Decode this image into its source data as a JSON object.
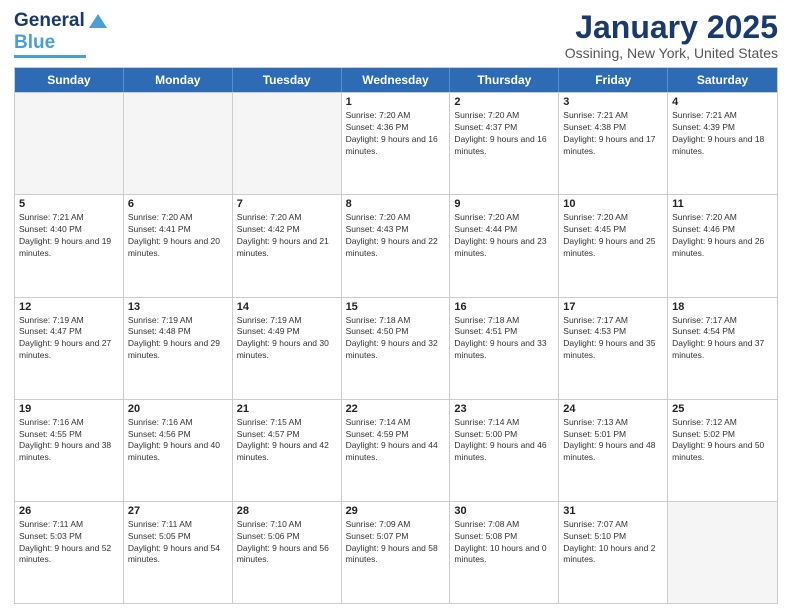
{
  "header": {
    "logo": {
      "line1": "General",
      "line2": "Blue"
    },
    "title": "January 2025",
    "location": "Ossining, New York, United States"
  },
  "days_of_week": [
    "Sunday",
    "Monday",
    "Tuesday",
    "Wednesday",
    "Thursday",
    "Friday",
    "Saturday"
  ],
  "weeks": [
    [
      {
        "day": "",
        "sunrise": "",
        "sunset": "",
        "daylight": "",
        "empty": true
      },
      {
        "day": "",
        "sunrise": "",
        "sunset": "",
        "daylight": "",
        "empty": true
      },
      {
        "day": "",
        "sunrise": "",
        "sunset": "",
        "daylight": "",
        "empty": true
      },
      {
        "day": "1",
        "sunrise": "Sunrise: 7:20 AM",
        "sunset": "Sunset: 4:36 PM",
        "daylight": "Daylight: 9 hours and 16 minutes.",
        "empty": false
      },
      {
        "day": "2",
        "sunrise": "Sunrise: 7:20 AM",
        "sunset": "Sunset: 4:37 PM",
        "daylight": "Daylight: 9 hours and 16 minutes.",
        "empty": false
      },
      {
        "day": "3",
        "sunrise": "Sunrise: 7:21 AM",
        "sunset": "Sunset: 4:38 PM",
        "daylight": "Daylight: 9 hours and 17 minutes.",
        "empty": false
      },
      {
        "day": "4",
        "sunrise": "Sunrise: 7:21 AM",
        "sunset": "Sunset: 4:39 PM",
        "daylight": "Daylight: 9 hours and 18 minutes.",
        "empty": false
      }
    ],
    [
      {
        "day": "5",
        "sunrise": "Sunrise: 7:21 AM",
        "sunset": "Sunset: 4:40 PM",
        "daylight": "Daylight: 9 hours and 19 minutes.",
        "empty": false
      },
      {
        "day": "6",
        "sunrise": "Sunrise: 7:20 AM",
        "sunset": "Sunset: 4:41 PM",
        "daylight": "Daylight: 9 hours and 20 minutes.",
        "empty": false
      },
      {
        "day": "7",
        "sunrise": "Sunrise: 7:20 AM",
        "sunset": "Sunset: 4:42 PM",
        "daylight": "Daylight: 9 hours and 21 minutes.",
        "empty": false
      },
      {
        "day": "8",
        "sunrise": "Sunrise: 7:20 AM",
        "sunset": "Sunset: 4:43 PM",
        "daylight": "Daylight: 9 hours and 22 minutes.",
        "empty": false
      },
      {
        "day": "9",
        "sunrise": "Sunrise: 7:20 AM",
        "sunset": "Sunset: 4:44 PM",
        "daylight": "Daylight: 9 hours and 23 minutes.",
        "empty": false
      },
      {
        "day": "10",
        "sunrise": "Sunrise: 7:20 AM",
        "sunset": "Sunset: 4:45 PM",
        "daylight": "Daylight: 9 hours and 25 minutes.",
        "empty": false
      },
      {
        "day": "11",
        "sunrise": "Sunrise: 7:20 AM",
        "sunset": "Sunset: 4:46 PM",
        "daylight": "Daylight: 9 hours and 26 minutes.",
        "empty": false
      }
    ],
    [
      {
        "day": "12",
        "sunrise": "Sunrise: 7:19 AM",
        "sunset": "Sunset: 4:47 PM",
        "daylight": "Daylight: 9 hours and 27 minutes.",
        "empty": false
      },
      {
        "day": "13",
        "sunrise": "Sunrise: 7:19 AM",
        "sunset": "Sunset: 4:48 PM",
        "daylight": "Daylight: 9 hours and 29 minutes.",
        "empty": false
      },
      {
        "day": "14",
        "sunrise": "Sunrise: 7:19 AM",
        "sunset": "Sunset: 4:49 PM",
        "daylight": "Daylight: 9 hours and 30 minutes.",
        "empty": false
      },
      {
        "day": "15",
        "sunrise": "Sunrise: 7:18 AM",
        "sunset": "Sunset: 4:50 PM",
        "daylight": "Daylight: 9 hours and 32 minutes.",
        "empty": false
      },
      {
        "day": "16",
        "sunrise": "Sunrise: 7:18 AM",
        "sunset": "Sunset: 4:51 PM",
        "daylight": "Daylight: 9 hours and 33 minutes.",
        "empty": false
      },
      {
        "day": "17",
        "sunrise": "Sunrise: 7:17 AM",
        "sunset": "Sunset: 4:53 PM",
        "daylight": "Daylight: 9 hours and 35 minutes.",
        "empty": false
      },
      {
        "day": "18",
        "sunrise": "Sunrise: 7:17 AM",
        "sunset": "Sunset: 4:54 PM",
        "daylight": "Daylight: 9 hours and 37 minutes.",
        "empty": false
      }
    ],
    [
      {
        "day": "19",
        "sunrise": "Sunrise: 7:16 AM",
        "sunset": "Sunset: 4:55 PM",
        "daylight": "Daylight: 9 hours and 38 minutes.",
        "empty": false
      },
      {
        "day": "20",
        "sunrise": "Sunrise: 7:16 AM",
        "sunset": "Sunset: 4:56 PM",
        "daylight": "Daylight: 9 hours and 40 minutes.",
        "empty": false
      },
      {
        "day": "21",
        "sunrise": "Sunrise: 7:15 AM",
        "sunset": "Sunset: 4:57 PM",
        "daylight": "Daylight: 9 hours and 42 minutes.",
        "empty": false
      },
      {
        "day": "22",
        "sunrise": "Sunrise: 7:14 AM",
        "sunset": "Sunset: 4:59 PM",
        "daylight": "Daylight: 9 hours and 44 minutes.",
        "empty": false
      },
      {
        "day": "23",
        "sunrise": "Sunrise: 7:14 AM",
        "sunset": "Sunset: 5:00 PM",
        "daylight": "Daylight: 9 hours and 46 minutes.",
        "empty": false
      },
      {
        "day": "24",
        "sunrise": "Sunrise: 7:13 AM",
        "sunset": "Sunset: 5:01 PM",
        "daylight": "Daylight: 9 hours and 48 minutes.",
        "empty": false
      },
      {
        "day": "25",
        "sunrise": "Sunrise: 7:12 AM",
        "sunset": "Sunset: 5:02 PM",
        "daylight": "Daylight: 9 hours and 50 minutes.",
        "empty": false
      }
    ],
    [
      {
        "day": "26",
        "sunrise": "Sunrise: 7:11 AM",
        "sunset": "Sunset: 5:03 PM",
        "daylight": "Daylight: 9 hours and 52 minutes.",
        "empty": false
      },
      {
        "day": "27",
        "sunrise": "Sunrise: 7:11 AM",
        "sunset": "Sunset: 5:05 PM",
        "daylight": "Daylight: 9 hours and 54 minutes.",
        "empty": false
      },
      {
        "day": "28",
        "sunrise": "Sunrise: 7:10 AM",
        "sunset": "Sunset: 5:06 PM",
        "daylight": "Daylight: 9 hours and 56 minutes.",
        "empty": false
      },
      {
        "day": "29",
        "sunrise": "Sunrise: 7:09 AM",
        "sunset": "Sunset: 5:07 PM",
        "daylight": "Daylight: 9 hours and 58 minutes.",
        "empty": false
      },
      {
        "day": "30",
        "sunrise": "Sunrise: 7:08 AM",
        "sunset": "Sunset: 5:08 PM",
        "daylight": "Daylight: 10 hours and 0 minutes.",
        "empty": false
      },
      {
        "day": "31",
        "sunrise": "Sunrise: 7:07 AM",
        "sunset": "Sunset: 5:10 PM",
        "daylight": "Daylight: 10 hours and 2 minutes.",
        "empty": false
      },
      {
        "day": "",
        "sunrise": "",
        "sunset": "",
        "daylight": "",
        "empty": true
      }
    ]
  ]
}
